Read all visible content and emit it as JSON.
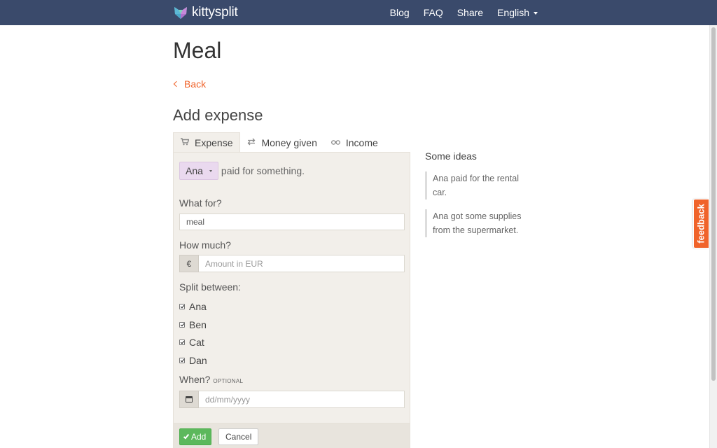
{
  "nav": {
    "brand": "kittysplit",
    "links": [
      "Blog",
      "FAQ",
      "Share"
    ],
    "language": "English"
  },
  "page": {
    "title": "Meal",
    "back_label": "Back",
    "section_title": "Add expense"
  },
  "tabs": [
    {
      "label": "Expense",
      "icon": "cart-icon",
      "active": true
    },
    {
      "label": "Money given",
      "icon": "exchange-icon",
      "active": false
    },
    {
      "label": "Income",
      "icon": "glasses-icon",
      "active": false
    }
  ],
  "form": {
    "payer": "Ana",
    "payer_suffix": "paid for something.",
    "what_for_label": "What for?",
    "what_for_value": "meal",
    "how_much_label": "How much?",
    "currency_symbol": "€",
    "amount_placeholder": "Amount in EUR",
    "split_label": "Split between:",
    "participants": [
      "Ana",
      "Ben",
      "Cat",
      "Dan"
    ],
    "when_label": "When?",
    "when_optional": "optional",
    "date_placeholder": "dd/mm/yyyy",
    "add_label": "Add",
    "cancel_label": "Cancel"
  },
  "ideas": {
    "title": "Some ideas",
    "items": [
      "Ana paid for the rental car.",
      "Ana got some supplies from the supermarket."
    ]
  },
  "feedback_label": "feedback",
  "colors": {
    "navbar": "#3a4a6b",
    "accent": "#f0632a",
    "panel": "#f2efea",
    "payer_chip": "#ead9ef",
    "add_button": "#5cb85c"
  }
}
